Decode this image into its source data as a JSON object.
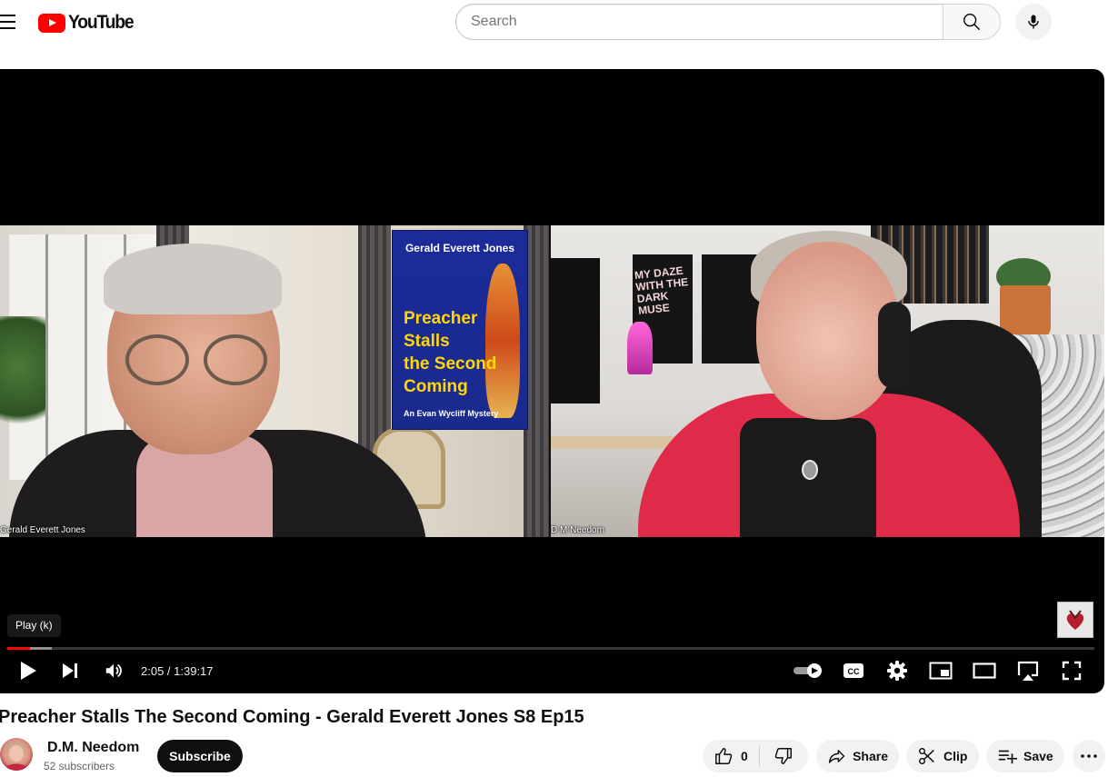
{
  "header": {
    "logo_text": "YouTube",
    "search_placeholder": "Search"
  },
  "player": {
    "tooltip": "Play (k)",
    "time_display": "2:05 / 1:39:17",
    "progress_played_fraction": 0.021,
    "progress_loaded_fraction": 0.041,
    "video_frame": {
      "left_participant_name": "Gerald Everett Jones",
      "right_participant_name": "D M Needom",
      "book_author": "Gerald Everett Jones",
      "book_title_lines": [
        "Preacher",
        "Stalls",
        "the Second",
        "Coming"
      ],
      "book_subtitle": "An Evan Wycliff Mystery",
      "poster_text": "MY DAZE WITH THE DARK MUSE"
    },
    "controls": [
      "play-icon",
      "next-icon",
      "volume-icon",
      "autoplay-toggle-icon",
      "closed-captions-icon",
      "settings-gear-icon",
      "miniplayer-icon",
      "theater-mode-icon",
      "cast-icon",
      "fullscreen-icon"
    ]
  },
  "video": {
    "title": "Preacher Stalls The Second Coming - Gerald Everett Jones S8 Ep15"
  },
  "channel": {
    "name": "D.M. Needom",
    "subscribers": "52 subscribers",
    "subscribe_label": "Subscribe"
  },
  "actions": {
    "like_count": "0",
    "share_label": "Share",
    "clip_label": "Clip",
    "save_label": "Save"
  },
  "colors": {
    "brand_red": "#ff0000",
    "jacket": "#e02a4a",
    "book_cover": "#1b2b9a",
    "book_title": "#ffd800"
  }
}
